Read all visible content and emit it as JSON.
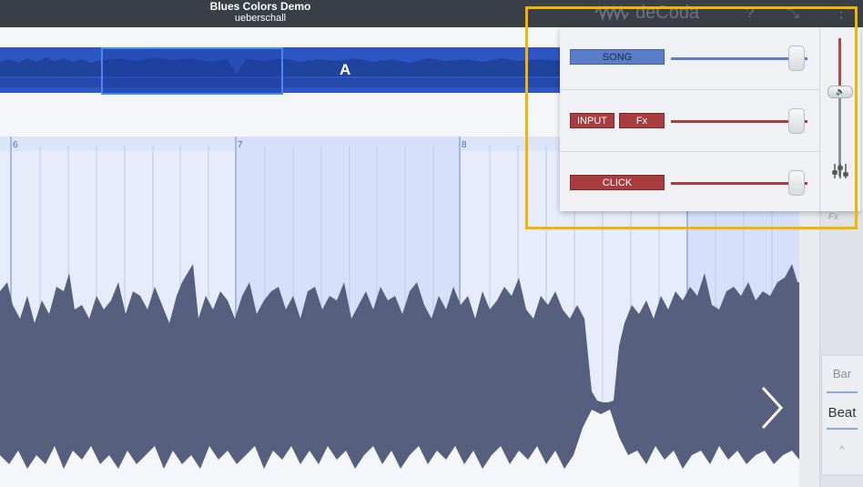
{
  "header": {
    "song_title": "Blues Colors Demo",
    "artist": "ueberschall",
    "brand": "deCoda",
    "help_icon": "question-mark-icon",
    "fullscreen_icon": "expand-icon",
    "menu_icon": "vertical-dots-icon"
  },
  "overview": {
    "section_label": "A"
  },
  "timeline": {
    "bar_numbers": [
      "6",
      "7",
      "8"
    ]
  },
  "mixer": {
    "tracks": [
      {
        "labels": [
          "SONG"
        ],
        "color": "#5b7cc7",
        "volume": 0.88
      },
      {
        "labels": [
          "INPUT",
          "Fx"
        ],
        "color": "#a83d40",
        "volume": 0.88
      },
      {
        "labels": [
          "CLICK"
        ],
        "color": "#a83d40",
        "volume": 0.88
      }
    ],
    "master_volume": 0.62,
    "master_icon": "speaker-icon",
    "eq_icon": "mixer-sliders-icon"
  },
  "side": {
    "fx_label": "Fx",
    "snap_bar": "Bar",
    "snap_beat": "Beat",
    "snap_caret": "^"
  },
  "colors": {
    "waveform": "#56607e",
    "overview": "#2d56c4",
    "highlight": "#f5b400",
    "red_track": "#a83d40",
    "blue_track": "#5b7cc7"
  }
}
